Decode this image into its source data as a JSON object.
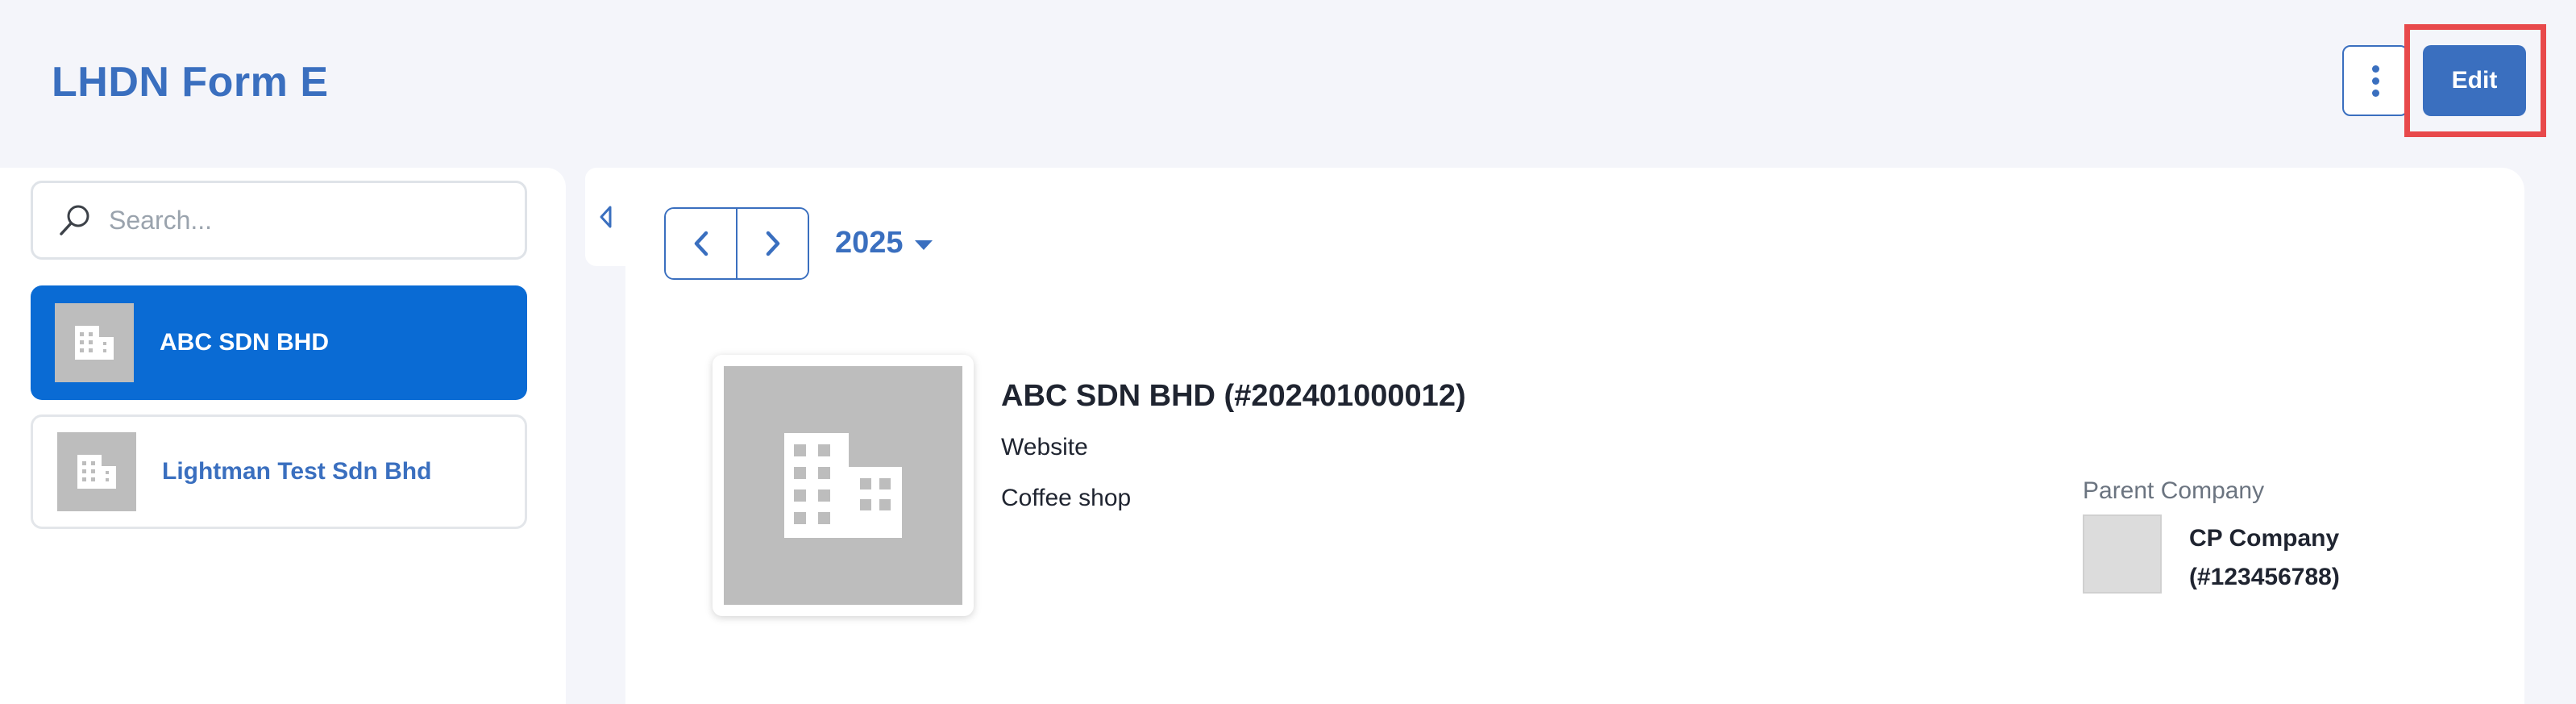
{
  "header": {
    "title": "LHDN Form E",
    "edit_label": "Edit",
    "more_icon": "more-vertical-icon"
  },
  "sidebar": {
    "search_placeholder": "Search...",
    "companies": [
      {
        "name": "ABC SDN BHD",
        "selected": true
      },
      {
        "name": "Lightman Test Sdn Bhd",
        "selected": false
      }
    ]
  },
  "main": {
    "year": "2025",
    "company": {
      "title": "ABC SDN BHD (#202401000012)",
      "website_label": "Website",
      "business": "Coffee shop"
    },
    "parent": {
      "label": "Parent Company",
      "name_line1": "CP Company",
      "name_line2": "(#123456788)"
    }
  },
  "colors": {
    "brand": "#3a6fbf",
    "selected": "#0a6bd4",
    "highlight": "#e8494b",
    "background": "#f4f5fa"
  }
}
